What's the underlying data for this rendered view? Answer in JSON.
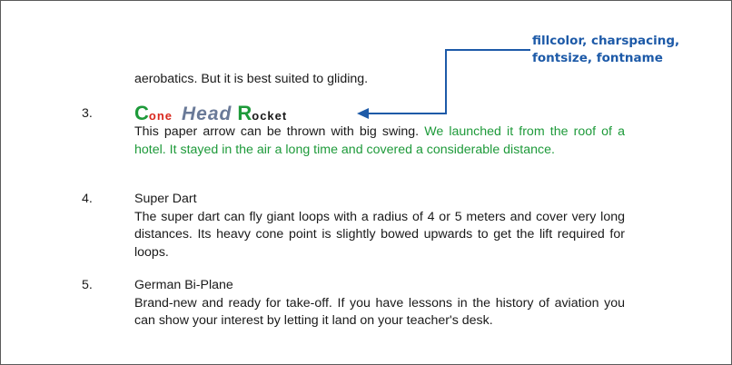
{
  "callout": {
    "line1": "fillcolor, charspacing,",
    "line2": "fontsize, fontname"
  },
  "fragment": "aerobatics. But it is best suited to gliding.",
  "items": [
    {
      "number": "3.",
      "title_parts": [
        {
          "text": "C",
          "color": "#1e9a3a",
          "size": 22,
          "style": "normal",
          "spacing": 0
        },
        {
          "text": "one",
          "color": "#d9281e",
          "size": 13,
          "style": "normal",
          "spacing": 1
        },
        {
          "text": "Head",
          "color": "#6a7a98",
          "size": 21,
          "style": "italic",
          "spacing": 1
        },
        {
          "text": "R",
          "color": "#1e9a3a",
          "size": 22,
          "style": "normal",
          "spacing": 0
        },
        {
          "text": "ocket",
          "color": "#1a1a1a",
          "size": 13,
          "style": "normal",
          "spacing": 1
        }
      ],
      "text_plain": "This paper arrow can be thrown with big swing.",
      "text_green": "We launched it from the roof of a hotel. It stayed in the air a long time and covered a considerable distance."
    },
    {
      "number": "4.",
      "title": "Super Dart",
      "text": "The super dart can fly giant loops with a radius of 4 or 5 meters and cover very long distances. Its heavy cone point is slightly bowed upwards to get the lift required for loops."
    },
    {
      "number": "5.",
      "title": "German Bi-Plane",
      "text": "Brand-new and ready for take-off. If you have lessons in the history of aviation you can show your interest by letting it land on your teacher's desk."
    }
  ],
  "colors": {
    "callout": "#1d5aa8",
    "highlight_text": "#1e9a3a",
    "border": "#5a5a5a"
  }
}
